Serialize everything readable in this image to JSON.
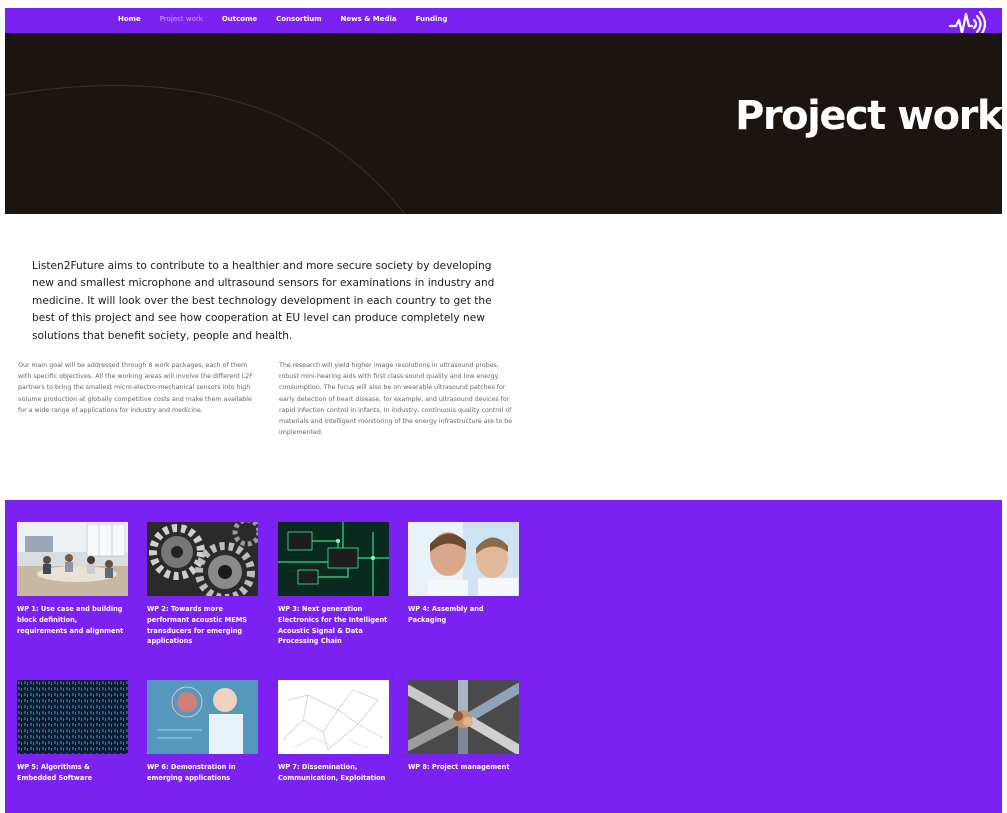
{
  "nav": {
    "items": [
      {
        "label": "Home",
        "active": false
      },
      {
        "label": "Project work",
        "active": true
      },
      {
        "label": "Outcome",
        "active": false
      },
      {
        "label": "Consortium",
        "active": false
      },
      {
        "label": "News & Media",
        "active": false
      },
      {
        "label": "Funding",
        "active": false
      }
    ],
    "logo_icon": "sound-wave-logo-icon"
  },
  "hero": {
    "title": "Project work"
  },
  "intro": "Listen2Future aims to contribute to a healthier and more secure society by developing new and smallest microphone and ultrasound sensors for examinations in industry and medicine. It will look over the best technology development in each country to get the best of this project and see how cooperation at EU level can produce completely new solutions that benefit society, people and health.",
  "columns": {
    "left": "Our main goal will be addressed through 8 work packages, each of them with specific objectives. All the working areas will involve the different L2F partners to bring the smallest micro-electro-mechanical sensors into high volume production at globally competitive costs and make them available for a wide range of applications for industry and medicine.",
    "right": "The research will yield higher image resolutions in ultrasound probes, robust mini-hearing aids with first class sound quality and low energy consumption. The focus will also be on wearable ultrasound patches for early detection of heart disease, for example, and ultrasound devices for rapid infection control in infants. In industry, continuous quality control of materials and intelligent monitoring of the energy infrastructure are to be implemented."
  },
  "work_packages": [
    {
      "title": "WP 1: Use case and building block definition, requirements and alignment",
      "image": "meeting-room-photo"
    },
    {
      "title": "WP 2: Towards more performant acoustic MEMS transducers for emerging applications",
      "image": "gears-photo"
    },
    {
      "title": "WP 3: Next generation Electronics for the Intelligent Acoustic Signal & Data Processing Chain",
      "image": "circuit-board-photo"
    },
    {
      "title": "WP 4: Assembly and Packaging",
      "image": "lab-scientists-photo"
    },
    {
      "title": "WP 5: Algorithms & Embedded Software",
      "image": "binary-code-photo"
    },
    {
      "title": "WP 6: Demonstration in emerging applications",
      "image": "doctor-hologram-photo"
    },
    {
      "title": "WP 7: Dissemination, Communication, Exploitation",
      "image": "network-sketch-photo"
    },
    {
      "title": "WP 8: Project management",
      "image": "team-hands-photo"
    }
  ]
}
